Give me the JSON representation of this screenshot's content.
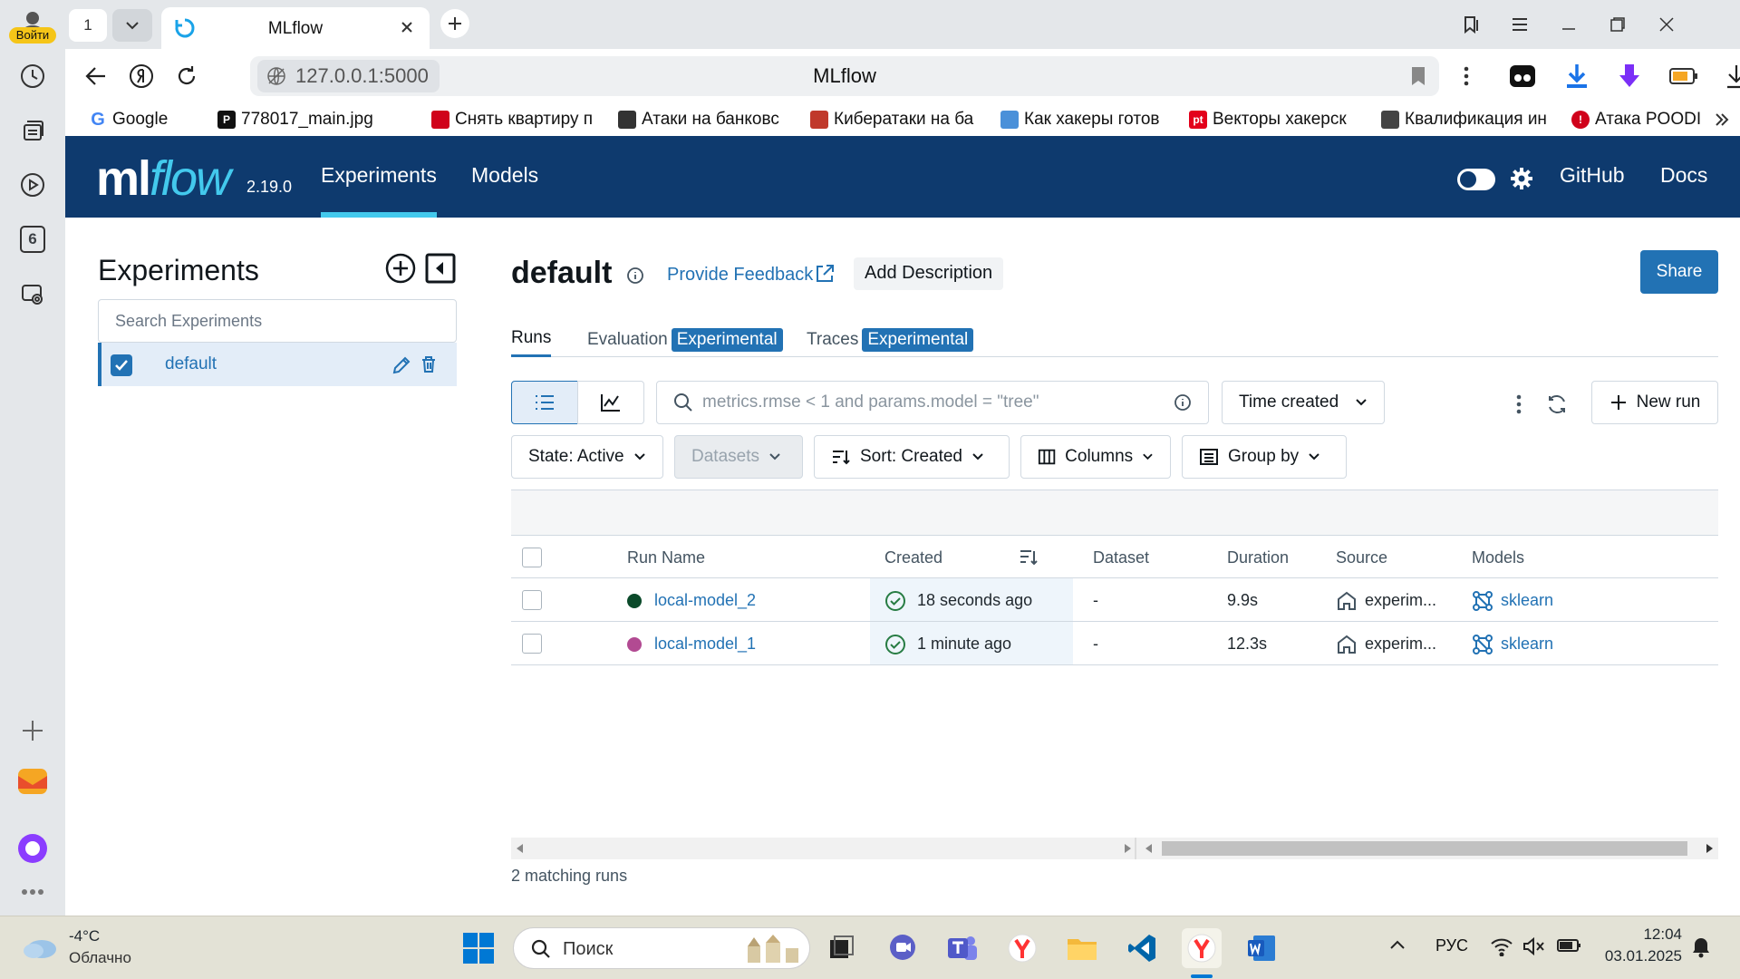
{
  "browser": {
    "login_label": "Войти",
    "tab_count": "1",
    "active_tab_title": "MLflow",
    "url": "127.0.0.1:5000",
    "page_title": "MLflow",
    "sidebar_badge": "6"
  },
  "bookmarks": [
    {
      "label": "Google",
      "color": "#ffffff"
    },
    {
      "label": "778017_main.jpg",
      "color": "#111111"
    },
    {
      "label": "Снять квартиру п",
      "color": "#d0021b"
    },
    {
      "label": "Атаки на банковс",
      "color": "#333333"
    },
    {
      "label": "Кибератаки на ба",
      "color": "#c0392b"
    },
    {
      "label": "Как хакеры готов",
      "color": "#4a90d9"
    },
    {
      "label": "Векторы хакерск",
      "color": "#e3001b"
    },
    {
      "label": "Квалификация ин",
      "color": "#444444"
    },
    {
      "label": "Атака POODI",
      "color": "#d0021b"
    }
  ],
  "mlflow": {
    "logo_ml": "ml",
    "logo_flow": "flow",
    "version": "2.19.0",
    "nav": {
      "experiments": "Experiments",
      "models": "Models",
      "github": "GitHub",
      "docs": "Docs"
    },
    "sidebar": {
      "title": "Experiments",
      "search_placeholder": "Search Experiments",
      "items": [
        {
          "name": "default",
          "checked": true
        }
      ]
    },
    "experiment": {
      "name": "default",
      "feedback_label": "Provide Feedback",
      "add_description_label": "Add Description",
      "share_label": "Share"
    },
    "tabs": {
      "runs": "Runs",
      "evaluation": "Evaluation",
      "traces": "Traces",
      "badge": "Experimental"
    },
    "controls": {
      "search_placeholder": "metrics.rmse < 1 and params.model = \"tree\"",
      "time_created": "Time created",
      "new_run": "New run",
      "state": "State: Active",
      "datasets": "Datasets",
      "sort": "Sort: Created",
      "columns": "Columns",
      "group_by": "Group by"
    },
    "table": {
      "headers": {
        "run_name": "Run Name",
        "created": "Created",
        "dataset": "Dataset",
        "duration": "Duration",
        "source": "Source",
        "models": "Models"
      },
      "rows": [
        {
          "run_name": "local-model_2",
          "color": "#0b4a2a",
          "created": "18 seconds ago",
          "dataset": "-",
          "duration": "9.9s",
          "source": "experim...",
          "model": "sklearn"
        },
        {
          "run_name": "local-model_1",
          "color": "#b24a92",
          "created": "1 minute ago",
          "dataset": "-",
          "duration": "12.3s",
          "source": "experim...",
          "model": "sklearn"
        }
      ]
    },
    "matching_runs": "2 matching runs"
  },
  "taskbar": {
    "temperature": "-4°C",
    "weather": "Облачно",
    "search_placeholder": "Поиск",
    "language": "РУС",
    "time": "12:04",
    "date": "03.01.2025"
  },
  "colors": {
    "header": "#0e3a6e",
    "accent": "#43c9ed",
    "primary": "#2272b4"
  }
}
